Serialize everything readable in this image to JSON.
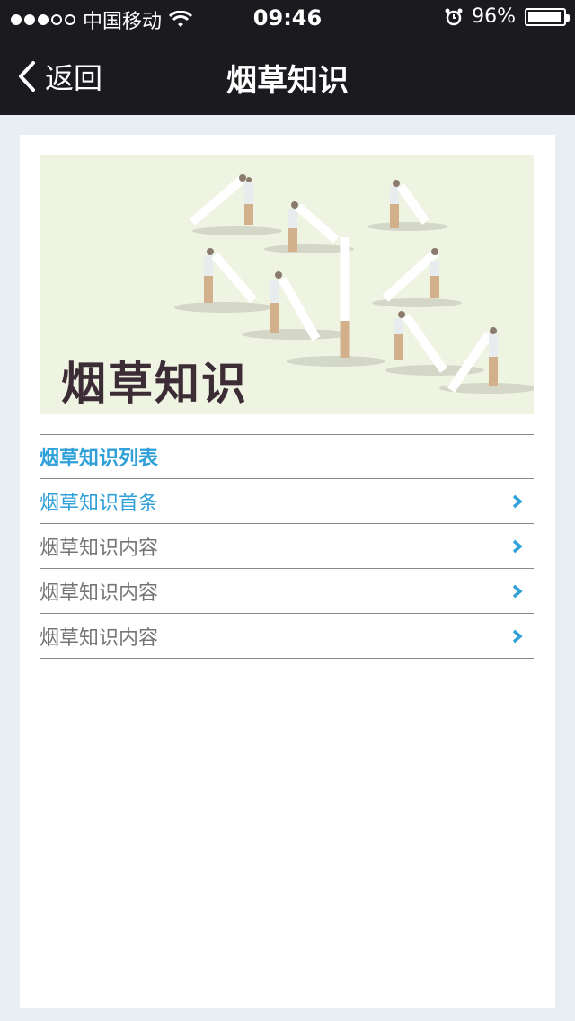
{
  "status_bar": {
    "carrier": "中国移动",
    "time": "09:46",
    "battery": "96%"
  },
  "nav": {
    "back_label": "返回",
    "title": "烟草知识"
  },
  "banner": {
    "title": "烟草知识"
  },
  "list": {
    "header": "烟草知识列表",
    "items": [
      {
        "label": "烟草知识首条"
      },
      {
        "label": "烟草知识内容"
      },
      {
        "label": "烟草知识内容"
      },
      {
        "label": "烟草知识内容"
      }
    ]
  },
  "colors": {
    "accent": "#2fa0d8",
    "header_bg": "#1b1a1f",
    "page_bg": "#e9eef3"
  }
}
